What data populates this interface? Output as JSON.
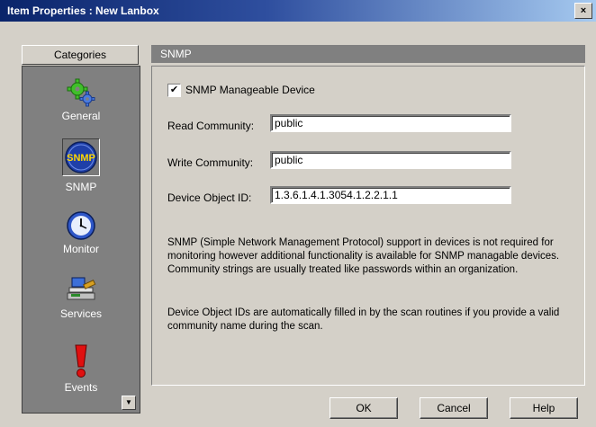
{
  "window": {
    "title": "Item Properties : New Lanbox",
    "close_glyph": "×"
  },
  "categories": {
    "header": "Categories",
    "items": [
      {
        "label": "General",
        "icon": "gears-icon"
      },
      {
        "label": "SNMP",
        "icon": "snmp-icon",
        "icon_text": "SNMP",
        "selected": true
      },
      {
        "label": "Monitor",
        "icon": "clock-icon"
      },
      {
        "label": "Services",
        "icon": "services-icon"
      },
      {
        "label": "Events",
        "icon": "exclamation-icon"
      }
    ],
    "scroll_glyph": "▼"
  },
  "section": {
    "header": "SNMP",
    "checkbox": {
      "label": "SNMP Manageable Device",
      "checked": true,
      "glyph": "✔"
    },
    "fields": {
      "read_community": {
        "label": "Read Community:",
        "value": "public"
      },
      "write_community": {
        "label": "Write Community:",
        "value": "public"
      },
      "device_object_id": {
        "label": "Device Object ID:",
        "value": "1.3.6.1.4.1.3054.1.2.2.1.1"
      }
    },
    "description1": "SNMP (Simple Network Management Protocol) support in devices is not required for monitoring however additional functionality is available for SNMP managable devices.  Community strings are usually treated like passwords within an organization.",
    "description2": "Device Object IDs are automatically filled in by the scan routines if you provide a valid community name during the scan."
  },
  "buttons": {
    "ok": "OK",
    "cancel": "Cancel",
    "help": "Help"
  }
}
